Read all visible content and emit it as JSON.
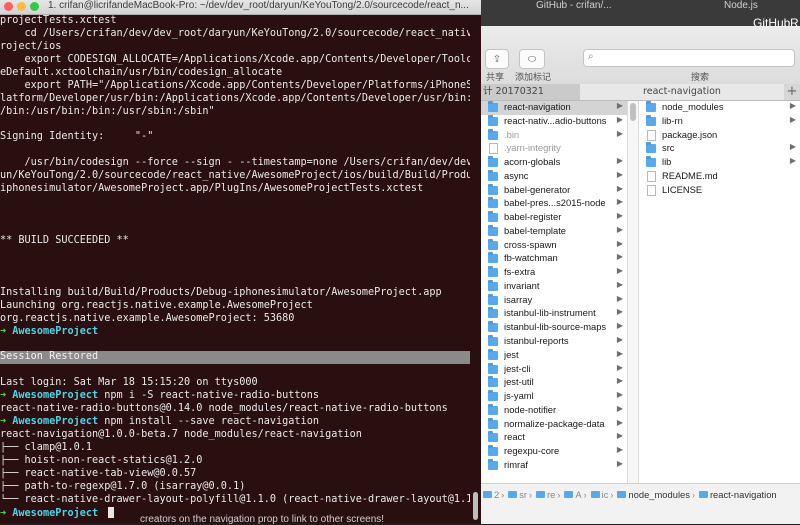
{
  "background": {
    "text1": "GitHub - crifan/...",
    "text2": "Node.js",
    "text3": "GitHub",
    "text4": "R"
  },
  "terminal": {
    "title": "1. crifan@licrifandeMacBook-Pro: ~/dev/dev_root/daryun/KeYouTong/2.0/sourcecode/react_n...",
    "lines": [
      {
        "t": "projectTests.xctest"
      },
      {
        "t": "    cd /Users/crifan/dev/dev_root/daryun/KeYouTong/2.0/sourcecode/react_native/AwesomeP"
      },
      {
        "t": "roject/ios"
      },
      {
        "t": "    export CODESIGN_ALLOCATE=/Applications/Xcode.app/Contents/Developer/Toolchains/Xcod"
      },
      {
        "t": "eDefault.xctoolchain/usr/bin/codesign_allocate"
      },
      {
        "t": "    export PATH=\"/Applications/Xcode.app/Contents/Developer/Platforms/iPhoneSimulator.p"
      },
      {
        "t": "latform/Developer/usr/bin:/Applications/Xcode.app/Contents/Developer/usr/bin:/usr/local"
      },
      {
        "t": "/bin:/usr/bin:/bin:/usr/sbin:/sbin\""
      },
      {
        "t": ""
      },
      {
        "t": "Signing Identity:     \"-\""
      },
      {
        "t": ""
      },
      {
        "t": "    /usr/bin/codesign --force --sign - --timestamp=none /Users/crifan/dev/dev_root/dary"
      },
      {
        "t": "un/KeYouTong/2.0/sourcecode/react_native/AwesomeProject/ios/build/Build/Products/Debug-"
      },
      {
        "t": "iphonesimulator/AwesomeProject.app/PlugIns/AwesomeProjectTests.xctest"
      },
      {
        "t": ""
      },
      {
        "t": ""
      },
      {
        "t": ""
      },
      {
        "t": "** BUILD SUCCEEDED **"
      },
      {
        "t": ""
      },
      {
        "t": ""
      },
      {
        "t": ""
      },
      {
        "t": "Installing build/Build/Products/Debug-iphonesimulator/AwesomeProject.app"
      },
      {
        "t": "Launching org.reactjs.native.example.AwesomeProject"
      },
      {
        "t": "org.reactjs.native.example.AwesomeProject: 53680"
      },
      {
        "prompt": true,
        "arrow": "➜",
        "dir": "AwesomeProject",
        "cmd": ""
      },
      {
        "t": ""
      },
      {
        "banner": true,
        "t": "Session Restored"
      },
      {
        "t": ""
      },
      {
        "t": "Last login: Sat Mar 18 15:15:20 on ttys000"
      },
      {
        "prompt": true,
        "arrow": "➜",
        "dir": "AwesomeProject",
        "cmd": " npm i -S react-native-radio-buttons"
      },
      {
        "t": "react-native-radio-buttons@0.14.0 node_modules/react-native-radio-buttons"
      },
      {
        "prompt": true,
        "arrow": "➜",
        "dir": "AwesomeProject",
        "cmd": " npm install --save react-navigation"
      },
      {
        "t": "react-navigation@1.0.0-beta.7 node_modules/react-navigation"
      },
      {
        "t": "├── clamp@1.0.1"
      },
      {
        "t": "├── hoist-non-react-statics@1.2.0"
      },
      {
        "t": "├── react-native-tab-view@0.0.57"
      },
      {
        "t": "├── path-to-regexp@1.7.0 (isarray@0.0.1)"
      },
      {
        "t": "└── react-native-drawer-layout-polyfill@1.1.0 (react-native-drawer-layout@1.1.6)"
      },
      {
        "prompt": true,
        "arrow": "➜",
        "dir": "AwesomeProject",
        "cmd": " ",
        "cursor": true
      }
    ],
    "bottom_text": "creators on the navigation prop to link to other screens!"
  },
  "finder": {
    "toolbar": {
      "share_label": "共享",
      "tag_label": "添加标记",
      "search_label": "搜索",
      "search_placeholder": ""
    },
    "tabs": {
      "left": "计 20170321",
      "right": "react-navigation",
      "add": "+"
    },
    "column1": [
      {
        "name": "react-navigation",
        "type": "folder",
        "selected": true
      },
      {
        "name": "react-nativ...adio-buttons",
        "type": "folder"
      },
      {
        "name": ".bin",
        "type": "folder",
        "dim": true
      },
      {
        "name": ".yarn-integrity",
        "type": "file",
        "dim": true
      },
      {
        "name": "acorn-globals",
        "type": "folder"
      },
      {
        "name": "async",
        "type": "folder"
      },
      {
        "name": "babel-generator",
        "type": "folder"
      },
      {
        "name": "babel-pres...s2015-node",
        "type": "folder"
      },
      {
        "name": "babel-register",
        "type": "folder"
      },
      {
        "name": "babel-template",
        "type": "folder"
      },
      {
        "name": "cross-spawn",
        "type": "folder"
      },
      {
        "name": "fb-watchman",
        "type": "folder"
      },
      {
        "name": "fs-extra",
        "type": "folder"
      },
      {
        "name": "invariant",
        "type": "folder"
      },
      {
        "name": "isarray",
        "type": "folder"
      },
      {
        "name": "istanbul-lib-instrument",
        "type": "folder"
      },
      {
        "name": "istanbul-lib-source-maps",
        "type": "folder"
      },
      {
        "name": "istanbul-reports",
        "type": "folder"
      },
      {
        "name": "jest",
        "type": "folder"
      },
      {
        "name": "jest-cli",
        "type": "folder"
      },
      {
        "name": "jest-util",
        "type": "folder"
      },
      {
        "name": "js-yaml",
        "type": "folder"
      },
      {
        "name": "node-notifier",
        "type": "folder"
      },
      {
        "name": "normalize-package-data",
        "type": "folder"
      },
      {
        "name": "react",
        "type": "folder"
      },
      {
        "name": "regexpu-core",
        "type": "folder"
      },
      {
        "name": "rimraf",
        "type": "folder"
      }
    ],
    "column2": [
      {
        "name": "node_modules",
        "type": "folder"
      },
      {
        "name": "lib-rn",
        "type": "folder"
      },
      {
        "name": "package.json",
        "type": "file"
      },
      {
        "name": "src",
        "type": "folder"
      },
      {
        "name": "lib",
        "type": "folder"
      },
      {
        "name": "README.md",
        "type": "file"
      },
      {
        "name": "LICENSE",
        "type": "file"
      }
    ],
    "pathbar": [
      {
        "label": "2",
        "short": true
      },
      {
        "label": "sr",
        "short": true
      },
      {
        "label": "re",
        "short": true
      },
      {
        "label": "A",
        "short": true
      },
      {
        "label": "ic",
        "short": true
      },
      {
        "label": "node_modules",
        "short": false
      },
      {
        "label": "react-navigation",
        "short": false
      }
    ],
    "colors": {
      "folder": "#5aa8ec",
      "selection": "#d4d4d4"
    }
  }
}
